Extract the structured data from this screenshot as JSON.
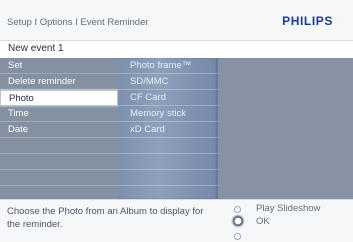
{
  "header": {
    "breadcrumb": "Setup I Options I Event Reminder",
    "brand": "PHILIPS"
  },
  "title": "New event 1",
  "menu": {
    "items": [
      "Set",
      "Delete reminder",
      "Photo",
      "Time",
      "Date"
    ],
    "selected_index": 2
  },
  "submenu": {
    "items": [
      "Photo frame™",
      "SD/MMC",
      "CF Card",
      "Memory stick",
      "xD Card"
    ]
  },
  "footer": {
    "hint": "Choose the Photo from an Album to display for the reminder.",
    "play_label": "Play Slideshow",
    "ok_label": "OK"
  },
  "colors": {
    "brand": "#1c3c8e",
    "panel": "#8d99a9",
    "submenu": "#8ea0bc",
    "selection": "#ffffff"
  }
}
